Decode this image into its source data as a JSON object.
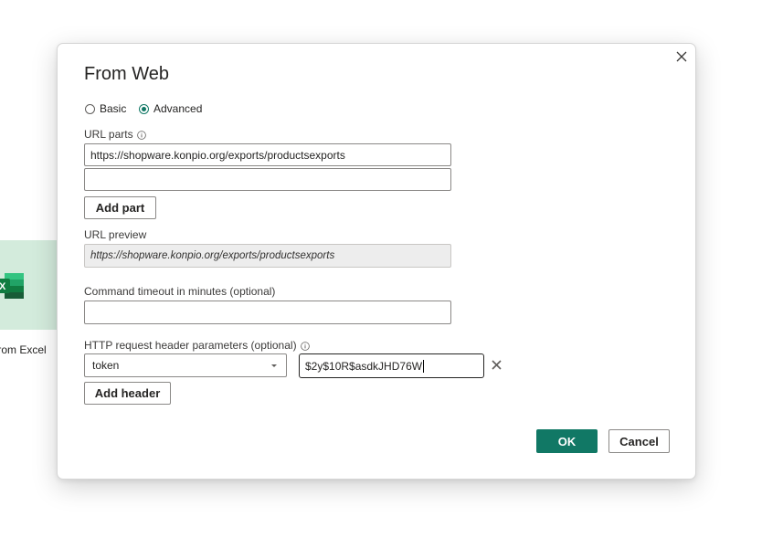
{
  "background": {
    "tile_label": "from Excel",
    "tile_icon": "excel-icon",
    "tile_color": "#d3ebdc"
  },
  "dialog": {
    "title": "From Web",
    "close_icon": "close-icon",
    "mode": {
      "options": [
        {
          "label": "Basic",
          "checked": false
        },
        {
          "label": "Advanced",
          "checked": true
        }
      ]
    },
    "url_parts": {
      "label": "URL parts",
      "parts": [
        "https://shopware.konpio.org/exports/productsexports",
        ""
      ],
      "add_part_label": "Add part"
    },
    "url_preview": {
      "label": "URL preview",
      "value": "https://shopware.konpio.org/exports/productsexports"
    },
    "timeout": {
      "label": "Command timeout in minutes (optional)",
      "value": ""
    },
    "http_headers": {
      "label": "HTTP request header parameters (optional)",
      "name": "token",
      "value": "$2y$10R$asdkJHD76W",
      "add_header_label": "Add header"
    },
    "buttons": {
      "ok_label": "OK",
      "cancel_label": "Cancel"
    }
  },
  "colors": {
    "accent": "#117865",
    "border": "#8a8886",
    "preview_bg": "#ededed"
  }
}
